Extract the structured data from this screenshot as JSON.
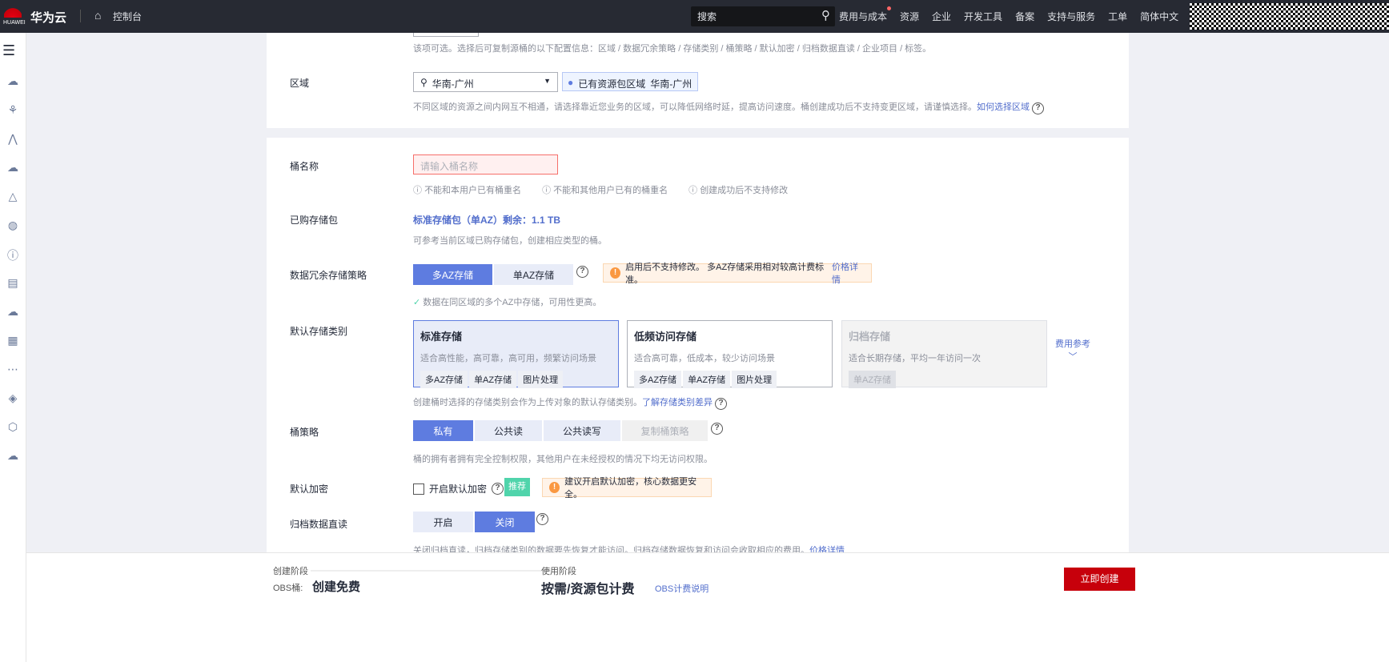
{
  "header": {
    "logo_text": "HUAWEI",
    "brand": "华为云",
    "console": "控制台",
    "search_placeholder": "搜索",
    "nav": [
      "费用与成本",
      "资源",
      "企业",
      "开发工具",
      "备案",
      "支持与服务",
      "工单",
      "简体中文"
    ]
  },
  "region_section": {
    "copy_hint": "该项可选。选择后可复制源桶的以下配置信息：区域 / 数据冗余策略 / 存储类别 / 桶策略 / 默认加密 / 归档数据直读 / 企业项目 / 标签。",
    "label": "区域",
    "selected": "华南-广州",
    "badge_label": "已有资源包区域",
    "badge_value": "华南-广州",
    "hint": "不同区域的资源之间内网互不相通，请选择靠近您业务的区域，可以降低网络时延，提高访问速度。桶创建成功后不支持变更区域，请谨慎选择。",
    "hint_link": "如何选择区域"
  },
  "bucket_name": {
    "label": "桶名称",
    "placeholder": "请输入桶名称",
    "rules": [
      "不能和本用户已有桶重名",
      "不能和其他用户已有的桶重名",
      "创建成功后不支持修改"
    ]
  },
  "package": {
    "label": "已购存储包",
    "value": "标准存储包（单AZ）剩余：1.1 TB",
    "hint": "可参考当前区域已购存储包，创建相应类型的桶。"
  },
  "redundancy": {
    "label": "数据冗余存储策略",
    "options": [
      "多AZ存储",
      "单AZ存储"
    ],
    "warning": "启用后不支持修改。 多AZ存储采用相对较高计费标准。",
    "warning_link": "价格详情",
    "hint": "数据在同区域的多个AZ中存储，可用性更高。"
  },
  "storage_class": {
    "label": "默认存储类别",
    "cards": [
      {
        "title": "标准存储",
        "desc": "适合高性能，高可靠，高可用，频繁访问场景",
        "tags": [
          "多AZ存储",
          "单AZ存储",
          "图片处理"
        ]
      },
      {
        "title": "低频访问存储",
        "desc": "适合高可靠，低成本，较少访问场景",
        "tags": [
          "多AZ存储",
          "单AZ存储",
          "图片处理"
        ]
      },
      {
        "title": "归档存储",
        "desc": "适合长期存储，平均一年访问一次",
        "tags": [
          "单AZ存储"
        ]
      }
    ],
    "fee_ref": "费用参考",
    "hint": "创建桶时选择的存储类别会作为上传对象的默认存储类别。",
    "hint_link": "了解存储类别差异"
  },
  "policy": {
    "label": "桶策略",
    "options": [
      "私有",
      "公共读",
      "公共读写",
      "复制桶策略"
    ],
    "hint": "桶的拥有者拥有完全控制权限，其他用户在未经授权的情况下均无访问权限。"
  },
  "encryption": {
    "label": "默认加密",
    "checkbox": "开启默认加密",
    "recommend": "推荐",
    "warning": "建议开启默认加密，核心数据更安全。"
  },
  "archive_read": {
    "label": "归档数据直读",
    "options": [
      "开启",
      "关闭"
    ],
    "hint": "关闭归档直读，归档存储类别的数据要先恢复才能访问。归档存储数据恢复和访问会收取相应的费用。",
    "hint_link": "价格详情"
  },
  "footer": {
    "stage1": "创建阶段",
    "obs_label": "OBS桶:",
    "stage1_value": "创建免费",
    "stage2": "使用阶段",
    "stage2_value": "按需/资源包计费",
    "billing_link": "OBS计费说明",
    "create_button": "立即创建"
  }
}
